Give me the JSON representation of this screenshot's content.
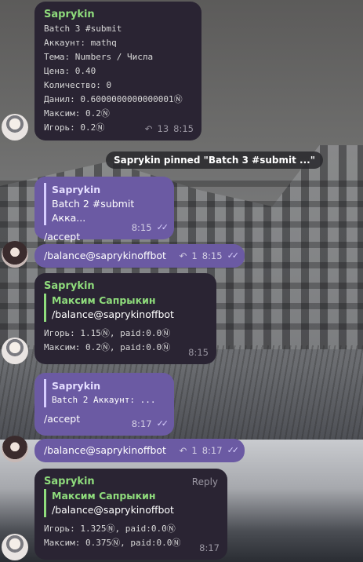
{
  "messages": {
    "m1": {
      "sender": "Saprykin",
      "lines": [
        "Batch 3 #submit",
        "Аккаунт: mathq",
        "Тема: Numbers / Числа",
        "Цена: 0.40",
        "Количество: 0",
        "Данил: 0.6000000000000001Ⓝ",
        "Максим: 0.2Ⓝ",
        "Игорь: 0.2Ⓝ"
      ],
      "views": "13",
      "time": "8:15"
    },
    "service": "Saprykin pinned \"Batch 3 #submit ...\"",
    "m2": {
      "quote_sender": "Saprykin",
      "quote_text": "Batch 2 #submit Акка...",
      "text": "/accept",
      "time": "8:15"
    },
    "m3": {
      "text": "/balance@saprykinoffbot",
      "replies": "1",
      "time": "8:15"
    },
    "m4": {
      "sender": "Saprykin",
      "quote_sender": "Максим Сапрыкин",
      "quote_text": "/balance@saprykinoffbot",
      "lines": [
        "Игорь: 1.15Ⓝ, paid:0.0Ⓝ",
        "Максим: 0.2Ⓝ, paid:0.0Ⓝ"
      ],
      "time": "8:15"
    },
    "m5": {
      "quote_sender": "Saprykin",
      "quote_text": "Batch 2 Аккаунт: ...",
      "text": "/accept",
      "time": "8:17"
    },
    "m6": {
      "text": "/balance@saprykinoffbot",
      "replies": "1",
      "time": "8:17"
    },
    "m7": {
      "sender": "Saprykin",
      "reply_label": "Reply",
      "quote_sender": "Максим Сапрыкин",
      "quote_text": "/balance@saprykinoffbot",
      "lines": [
        "Игорь: 1.325Ⓝ, paid:0.0Ⓝ",
        "Максим: 0.375Ⓝ, paid:0.0Ⓝ"
      ],
      "time": "8:17"
    }
  },
  "colors": {
    "incoming": "#2a2433",
    "outgoing": "#6b5aa3",
    "sender_green": "#8fdc7c"
  }
}
